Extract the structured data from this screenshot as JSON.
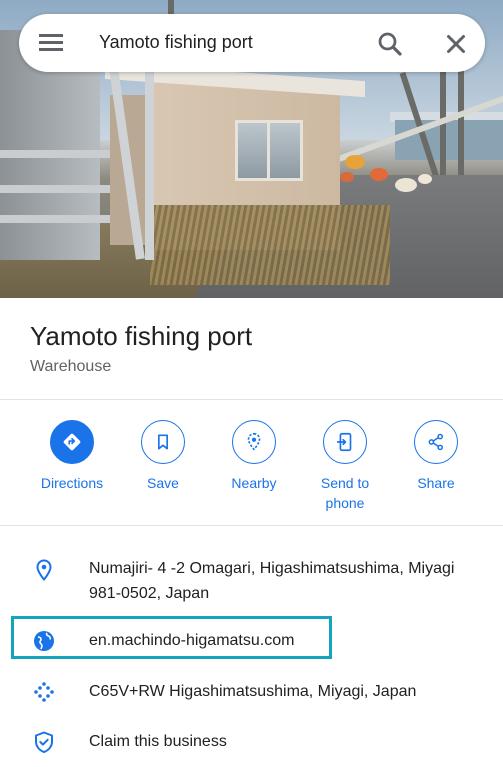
{
  "search": {
    "query": "Yamoto fishing port"
  },
  "place": {
    "name": "Yamoto fishing port",
    "category": "Warehouse"
  },
  "actions": [
    {
      "label": "Directions",
      "icon": "directions-icon"
    },
    {
      "label": "Save",
      "icon": "bookmark-icon"
    },
    {
      "label": "Nearby",
      "icon": "nearby-icon"
    },
    {
      "label": "Send to\nphone",
      "icon": "send-to-phone-icon"
    },
    {
      "label": "Share",
      "icon": "share-icon"
    }
  ],
  "info": {
    "address": "Numajiri- 4 -2 Omagari, Higashimatsushima, Miyagi 981-0502, Japan",
    "website": "en.machindo-higamatsu.com",
    "plus_code": "C65V+RW Higashimatsushima, Miyagi, Japan",
    "claim": "Claim this business"
  },
  "colors": {
    "accent": "#1a73e8",
    "highlight_border": "#14a4c0"
  }
}
